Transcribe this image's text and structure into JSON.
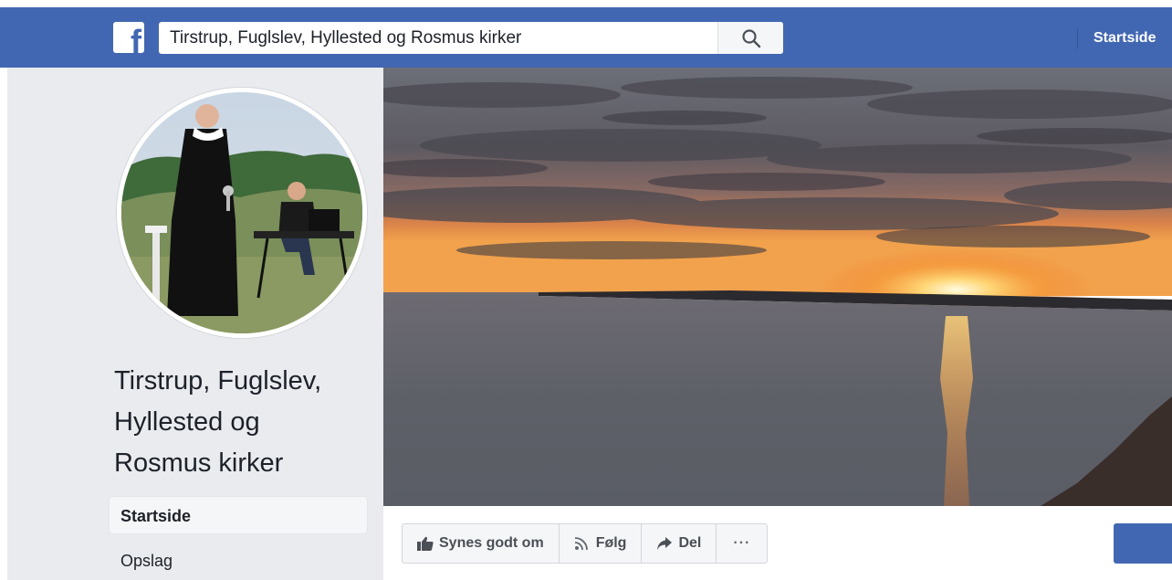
{
  "topbar": {
    "logo_letter": "f",
    "search_value": "Tirstrup, Fuglslev, Hyllested og Rosmus kirker",
    "search_icon": "search-icon",
    "nav_link": "Startside",
    "bar_color": "#4267b2"
  },
  "page": {
    "name_line1": "Tirstrup, Fuglslev,",
    "name_line2": "Hyllested og",
    "name_line3": "Rosmus kirker"
  },
  "sidebar": {
    "items": [
      {
        "label": "Startside",
        "active": true
      },
      {
        "label": "Opslag",
        "active": false
      }
    ]
  },
  "actions": {
    "like_label": "Synes godt om",
    "like_icon": "thumbs-up-icon",
    "follow_label": "Følg",
    "follow_icon": "rss-icon",
    "share_label": "Del",
    "share_icon": "share-arrow-icon",
    "more_label": "···"
  }
}
